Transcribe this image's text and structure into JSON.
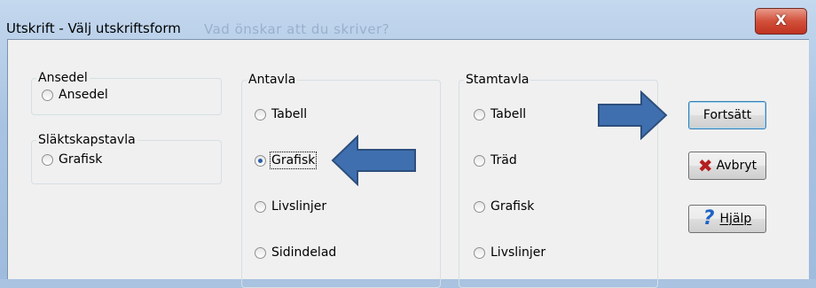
{
  "window": {
    "title": "Utskrift - Välj utskriftsform",
    "background_title": "Vad önskar att du skriver?"
  },
  "close": {
    "label": "X"
  },
  "groups": {
    "ansedel": {
      "label": "Ansedel",
      "options": [
        "Ansedel"
      ]
    },
    "slaktskap": {
      "label": "Släktskapstavla",
      "options": [
        "Grafisk"
      ]
    },
    "antavla": {
      "label": "Antavla",
      "options": [
        "Tabell",
        "Grafisk",
        "Livslinjer",
        "Sidindelad"
      ],
      "selected": "Grafisk"
    },
    "stamtavla": {
      "label": "Stamtavla",
      "options": [
        "Tabell",
        "Träd",
        "Grafisk",
        "Livslinjer"
      ]
    }
  },
  "buttons": {
    "continue": "Fortsätt",
    "cancel": "Avbryt",
    "help": "Hjälp"
  },
  "icons": {
    "cancel": "red-x-icon",
    "help": "question-mark-icon",
    "arrows": "blue-arrow-icon"
  },
  "colors": {
    "arrow": "#3f6faf",
    "arrow_border": "#2d4f7c",
    "selected_dot": "#2b5ea8"
  }
}
